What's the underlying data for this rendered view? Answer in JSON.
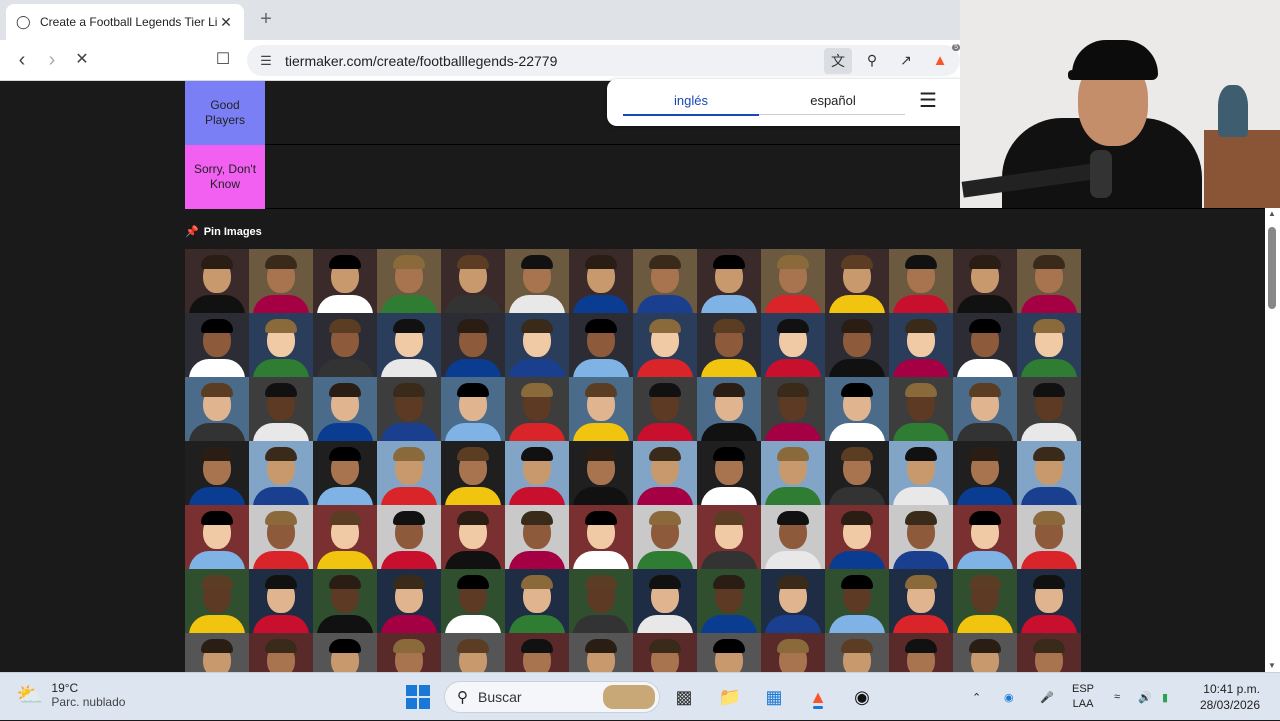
{
  "browser": {
    "tab_title": "Create a Football Legends Tier Li",
    "new_tab_symbol": "+",
    "url": "tiermaker.com/create/footballlegends-22779",
    "shield_count": "5"
  },
  "translate_bar": {
    "languages": [
      "inglés",
      "español"
    ],
    "selected": "inglés"
  },
  "tiers": [
    {
      "label": "Good Players",
      "color": "#7b7ff5"
    },
    {
      "label": "Sorry, Don't Know",
      "color": "#f160f1"
    }
  ],
  "pin_images": {
    "label": "Pin Images"
  },
  "image_grid": {
    "columns": 14,
    "visible_rows": 7,
    "item_type": "football player portrait"
  },
  "taskbar": {
    "weather_temp": "19°C",
    "weather_desc": "Parc. nublado",
    "search_placeholder": "Buscar",
    "language_line1": "ESP",
    "language_line2": "LAA",
    "time": "10:41 p.m.",
    "date": "28/03/2026"
  }
}
